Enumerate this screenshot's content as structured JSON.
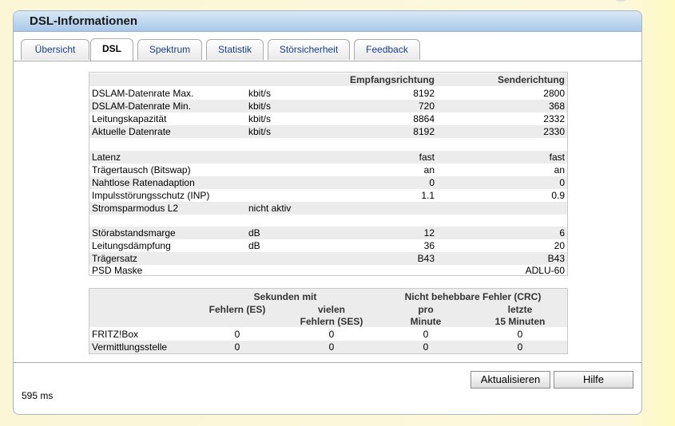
{
  "title": "DSL-Informationen",
  "tabs": [
    "Übersicht",
    "DSL",
    "Spektrum",
    "Statistik",
    "Störsicherheit",
    "Feedback"
  ],
  "active_tab": "DSL",
  "table1": {
    "headers": {
      "down": "Empfangsrichtung",
      "up": "Senderichtung"
    },
    "rows": [
      {
        "label": "DSLAM-Datenrate Max.",
        "unit": "kbit/s",
        "down": "8192",
        "up": "2800"
      },
      {
        "label": "DSLAM-Datenrate Min.",
        "unit": "kbit/s",
        "down": "720",
        "up": "368"
      },
      {
        "label": "Leitungskapazität",
        "unit": "kbit/s",
        "down": "8864",
        "up": "2332"
      },
      {
        "label": "Aktuelle Datenrate",
        "unit": "kbit/s",
        "down": "8192",
        "up": "2330"
      },
      {
        "label": "Latenz",
        "unit": "",
        "down": "fast",
        "up": "fast"
      },
      {
        "label": "Trägertausch (Bitswap)",
        "unit": "",
        "down": "an",
        "up": "an"
      },
      {
        "label": "Nahtlose Ratenadaption",
        "unit": "",
        "down": "0",
        "up": "0"
      },
      {
        "label": "Impulsstörungsschutz (INP)",
        "unit": "",
        "down": "1.1",
        "up": "0.9"
      },
      {
        "label": "Stromsparmodus L2",
        "unit": "nicht aktiv",
        "down": "",
        "up": ""
      },
      {
        "label": "Störabstandsmarge",
        "unit": "dB",
        "down": "12",
        "up": "6"
      },
      {
        "label": "Leitungsdämpfung",
        "unit": "dB",
        "down": "36",
        "up": "20"
      },
      {
        "label": "Trägersatz",
        "unit": "",
        "down": "B43",
        "up": "B43"
      },
      {
        "label": "PSD Maske",
        "unit": "",
        "down": "",
        "up": "ADLU-60"
      }
    ]
  },
  "table2": {
    "group1": "Sekunden mit",
    "group2": "Nicht behebbare Fehler (CRC)",
    "col1": "Fehlern (ES)",
    "col2a": "vielen",
    "col2b": "Fehlern (SES)",
    "col3a": "pro",
    "col3b": "Minute",
    "col4a": "letzte",
    "col4b": "15 Minuten",
    "rows": [
      {
        "label": "FRITZ!Box",
        "es": "0",
        "ses": "0",
        "pro_min": "0",
        "last15": "0"
      },
      {
        "label": "Vermittlungsstelle",
        "es": "0",
        "ses": "0",
        "pro_min": "0",
        "last15": "0"
      }
    ]
  },
  "buttons": {
    "refresh": "Aktualisieren",
    "help": "Hilfe"
  },
  "timing": "595 ms"
}
